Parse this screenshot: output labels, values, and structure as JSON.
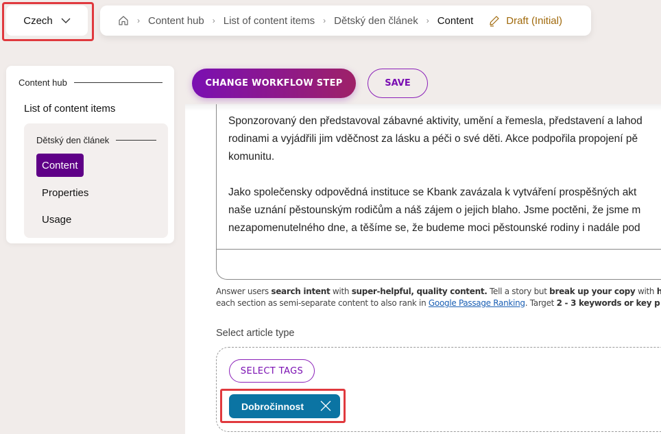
{
  "language_selector": {
    "value": "Czech",
    "icon": "chevron-down-icon"
  },
  "breadcrumb": {
    "home_icon": "home-icon",
    "items": [
      "Content hub",
      "List of content items",
      "Dětský den článek",
      "Content"
    ],
    "separator": "›",
    "status": {
      "icon": "pencil-icon",
      "label": "Draft (Initial)",
      "color": "#a0690b"
    }
  },
  "sidebar": {
    "group_title": "Content hub",
    "list_link": "List of content items",
    "sub_title": "Dětský den článek",
    "items": [
      {
        "label": "Content",
        "active": true
      },
      {
        "label": "Properties",
        "active": false
      },
      {
        "label": "Usage",
        "active": false
      }
    ]
  },
  "toolbar": {
    "workflow_label": "CHANGE WORKFLOW STEP",
    "save_label": "SAVE"
  },
  "editor": {
    "paragraphs": [
      [
        "Sponzorovaný den představoval zábavné aktivity, umění a řemesla, představení a lahod",
        "rodinami a vyjádřili jim vděčnost za lásku a péči o své děti. Akce podpořila propojení pě",
        "komunitu."
      ],
      [
        "Jako společensky odpovědná instituce se Kbank zavázala k vytváření prospěšných akt",
        "naše uznání pěstounským rodičům a náš zájem o jejich blaho. Jsme poctěni, že jsme m",
        "nezapomenutelného dne, a těšíme se, že budeme moci pěstounské rodiny i nadále pod"
      ]
    ]
  },
  "hint": {
    "line1": {
      "t1": "Answer users ",
      "b1": "search intent",
      "t2": " with ",
      "b2": "super-helpful, quality content.",
      "t3": " Tell a story but ",
      "b3": "break up your copy",
      "t4": " with ",
      "b4": "hea"
    },
    "line2": {
      "t1": "each section as semi-separate content to also rank in ",
      "link": "Google Passage Ranking",
      "t2": ". Target ",
      "b1": "2 - 3 keywords or key p"
    }
  },
  "article_type": {
    "label": "Select article type",
    "select_tags_label": "SELECT TAGS",
    "tags": [
      {
        "label": "Dobročinnost",
        "color": "#0b74a3",
        "remove_icon": "close-icon"
      }
    ]
  },
  "colors": {
    "accent_purple": "#7a0fb2",
    "active_nav": "#5f0087",
    "highlight_red": "#e0393e",
    "tag_blue": "#0b74a3"
  }
}
